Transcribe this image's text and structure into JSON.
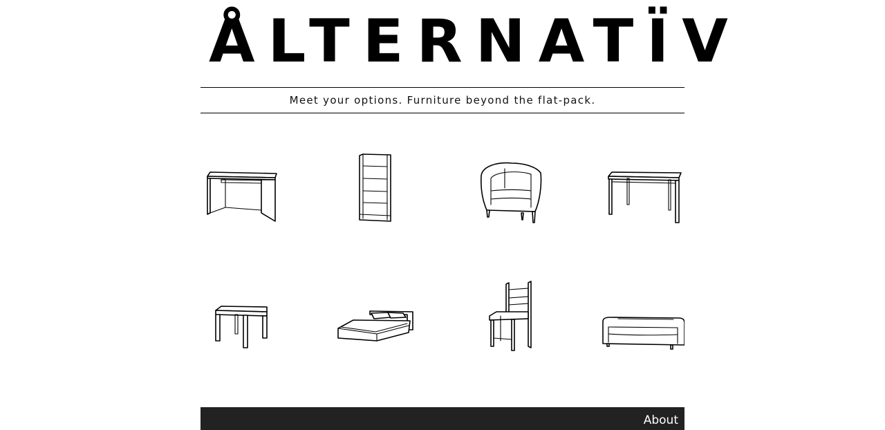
{
  "header": {
    "logo_text": "ÅLTERNATÏV",
    "tagline": "Meet your options. Furniture beyond the flat-pack."
  },
  "catalog": {
    "items": [
      {
        "icon": "desk-icon"
      },
      {
        "icon": "bookcase-icon"
      },
      {
        "icon": "armchair-icon"
      },
      {
        "icon": "dining-table-icon"
      },
      {
        "icon": "side-table-icon"
      },
      {
        "icon": "bed-icon"
      },
      {
        "icon": "chair-icon"
      },
      {
        "icon": "sofa-icon"
      }
    ]
  },
  "footer": {
    "about_label": "About",
    "background": "#222222"
  }
}
